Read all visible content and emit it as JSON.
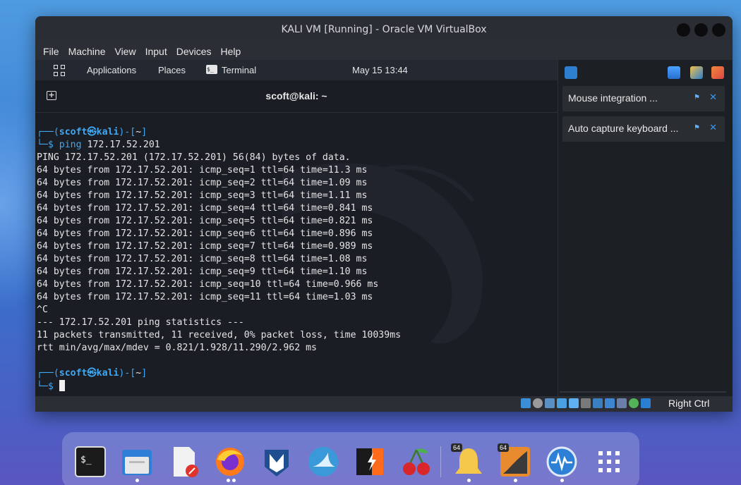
{
  "window": {
    "title": "KALI VM [Running] - Oracle VM VirtualBox"
  },
  "menubar": {
    "items": [
      "File",
      "Machine",
      "View",
      "Input",
      "Devices",
      "Help"
    ]
  },
  "kali_panel": {
    "applications": "Applications",
    "places": "Places",
    "terminal": "Terminal",
    "clock": "May 15  13:44"
  },
  "terminal": {
    "title": "scoft@kali: ~",
    "prompt": {
      "user": "scoft",
      "at": "㉿",
      "host": "kali",
      "dir": "~"
    },
    "command": "ping",
    "command_arg": "172.17.52.201",
    "output": [
      "PING 172.17.52.201 (172.17.52.201) 56(84) bytes of data.",
      "64 bytes from 172.17.52.201: icmp_seq=1 ttl=64 time=11.3 ms",
      "64 bytes from 172.17.52.201: icmp_seq=2 ttl=64 time=1.09 ms",
      "64 bytes from 172.17.52.201: icmp_seq=3 ttl=64 time=1.11 ms",
      "64 bytes from 172.17.52.201: icmp_seq=4 ttl=64 time=0.841 ms",
      "64 bytes from 172.17.52.201: icmp_seq=5 ttl=64 time=0.821 ms",
      "64 bytes from 172.17.52.201: icmp_seq=6 ttl=64 time=0.896 ms",
      "64 bytes from 172.17.52.201: icmp_seq=7 ttl=64 time=0.989 ms",
      "64 bytes from 172.17.52.201: icmp_seq=8 ttl=64 time=1.08 ms",
      "64 bytes from 172.17.52.201: icmp_seq=9 ttl=64 time=1.10 ms",
      "64 bytes from 172.17.52.201: icmp_seq=10 ttl=64 time=0.966 ms",
      "64 bytes from 172.17.52.201: icmp_seq=11 ttl=64 time=1.03 ms",
      "^C",
      "--- 172.17.52.201 ping statistics ---",
      "11 packets transmitted, 11 received, 0% packet loss, time 10039ms",
      "rtt min/avg/max/mdev = 0.821/1.928/11.290/2.962 ms"
    ]
  },
  "notifications": {
    "items": [
      {
        "label": "Mouse integration ..."
      },
      {
        "label": "Auto capture keyboard ..."
      }
    ]
  },
  "statusbar": {
    "host_key": "Right Ctrl"
  },
  "dock": {
    "badges": [
      "64",
      "64"
    ]
  },
  "colors": {
    "accent_blue": "#3fa9f5",
    "terminal_bg": "#1a1d24"
  }
}
